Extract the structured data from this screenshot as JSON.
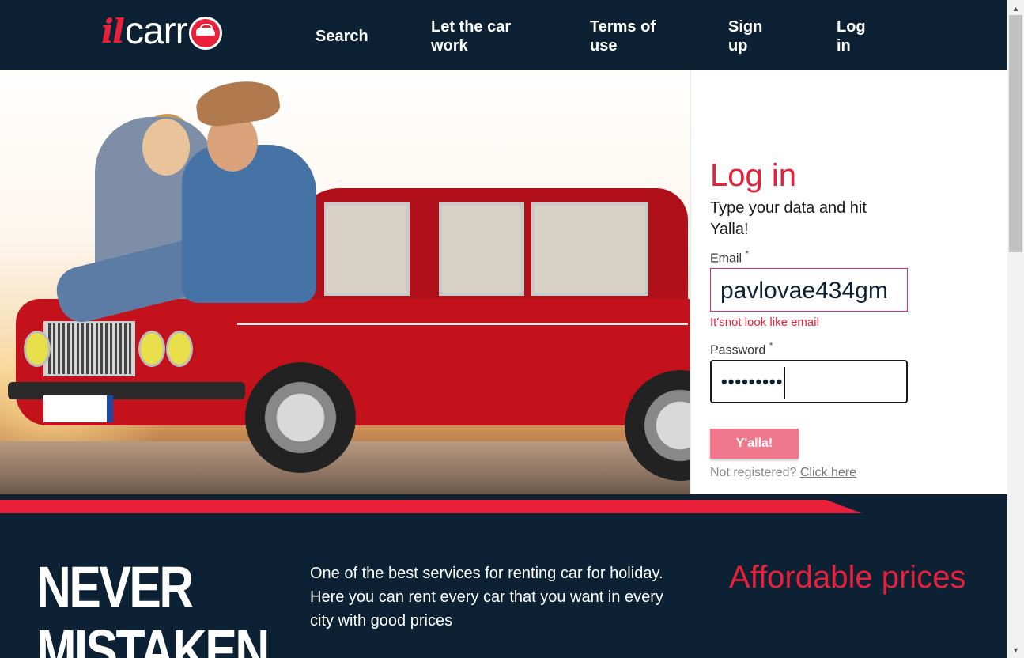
{
  "header": {
    "logo": {
      "il": "il",
      "carr": "carr"
    },
    "nav": [
      {
        "label": "Search"
      },
      {
        "label": "Let the car work"
      },
      {
        "label": "Terms of use"
      },
      {
        "label": "Sign up"
      },
      {
        "label": "Log in"
      }
    ]
  },
  "login": {
    "title": "Log in",
    "subtitle": "Type your data and hit Yalla!",
    "email_label": "Email",
    "required_mark": "*",
    "email_value": "pavlovae434gm",
    "email_error": "It'snot look like email",
    "password_label": "Password",
    "password_mask": "•••••••••",
    "submit_label": "Y'alla!",
    "not_registered": "Not registered?",
    "click_here": "Click here"
  },
  "bottom": {
    "never_line1": "NEVER",
    "never_line2": "MISTAKEN",
    "description": "One of the best services for renting car for holiday. Here you can rent every car that you want in every city with good prices",
    "affordable": "Affordable prices"
  },
  "colors": {
    "navy": "#0c2234",
    "brand_red": "#e8203a",
    "button_pink": "#f0788c"
  },
  "icons": {
    "logo_o": "car-in-circle-icon",
    "scroll_up": "triangle-up-icon",
    "scroll_down": "triangle-down-icon"
  }
}
